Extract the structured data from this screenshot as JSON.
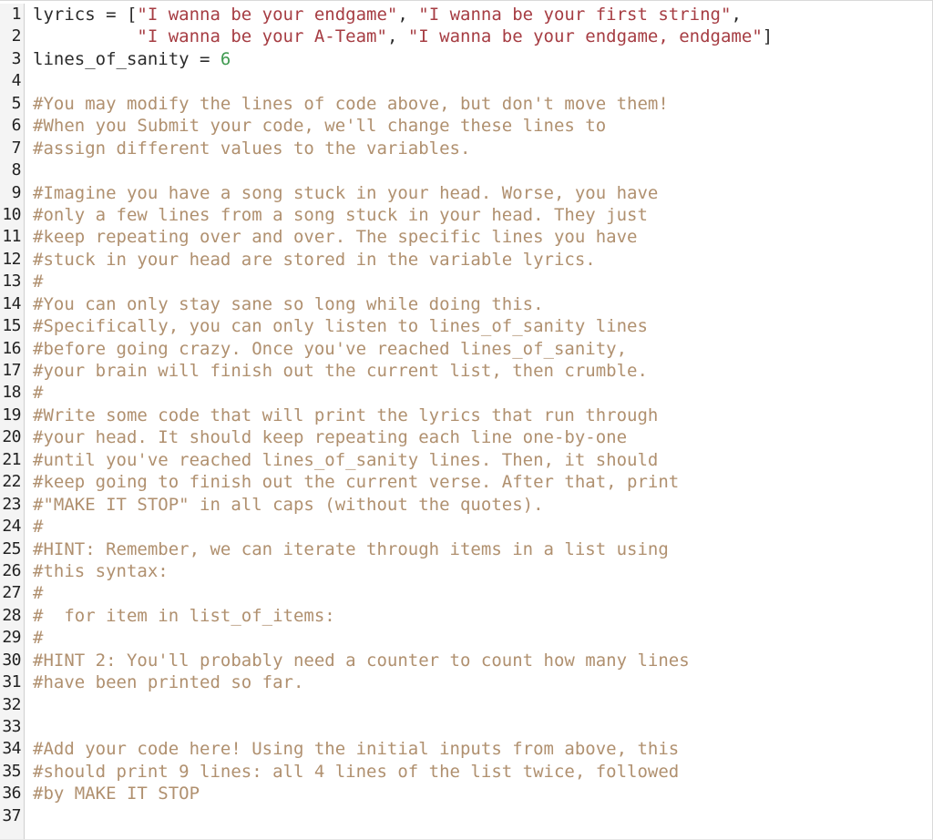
{
  "editor": {
    "language": "python",
    "total_lines": 37,
    "colors": {
      "background": "#ffffff",
      "gutter_background": "#f4f4f4",
      "gutter_border": "#cfcfcf",
      "line_number_text": "#222222",
      "plain_text": "#2b2b2b",
      "string": "#a63d43",
      "number": "#3f9a50",
      "comment": "#b0906f"
    },
    "line_numbers": [
      "1",
      "2",
      "3",
      "4",
      "5",
      "6",
      "7",
      "8",
      "9",
      "10",
      "11",
      "12",
      "13",
      "14",
      "15",
      "16",
      "17",
      "18",
      "19",
      "20",
      "21",
      "22",
      "23",
      "24",
      "25",
      "26",
      "27",
      "28",
      "29",
      "30",
      "31",
      "32",
      "33",
      "34",
      "35",
      "36",
      "37"
    ],
    "lines": [
      {
        "n": "1",
        "tokens": [
          {
            "t": "lyrics = [",
            "c": "plain"
          },
          {
            "t": "\"I wanna be your endgame\"",
            "c": "string"
          },
          {
            "t": ", ",
            "c": "plain"
          },
          {
            "t": "\"I wanna be your first string\"",
            "c": "string"
          },
          {
            "t": ",",
            "c": "plain"
          }
        ]
      },
      {
        "n": "2",
        "tokens": [
          {
            "t": "          ",
            "c": "plain"
          },
          {
            "t": "\"I wanna be your A-Team\"",
            "c": "string"
          },
          {
            "t": ", ",
            "c": "plain"
          },
          {
            "t": "\"I wanna be your endgame, endgame\"",
            "c": "string"
          },
          {
            "t": "]",
            "c": "plain"
          }
        ]
      },
      {
        "n": "3",
        "tokens": [
          {
            "t": "lines_of_sanity = ",
            "c": "plain"
          },
          {
            "t": "6",
            "c": "number"
          }
        ]
      },
      {
        "n": "4",
        "tokens": []
      },
      {
        "n": "5",
        "tokens": [
          {
            "t": "#You may modify the lines of code above, but don't move them!",
            "c": "comment"
          }
        ]
      },
      {
        "n": "6",
        "tokens": [
          {
            "t": "#When you Submit your code, we'll change these lines to",
            "c": "comment"
          }
        ]
      },
      {
        "n": "7",
        "tokens": [
          {
            "t": "#assign different values to the variables.",
            "c": "comment"
          }
        ]
      },
      {
        "n": "8",
        "tokens": []
      },
      {
        "n": "9",
        "tokens": [
          {
            "t": "#Imagine you have a song stuck in your head. Worse, you have",
            "c": "comment"
          }
        ]
      },
      {
        "n": "10",
        "tokens": [
          {
            "t": "#only a few lines from a song stuck in your head. They just",
            "c": "comment"
          }
        ]
      },
      {
        "n": "11",
        "tokens": [
          {
            "t": "#keep repeating over and over. The specific lines you have",
            "c": "comment"
          }
        ]
      },
      {
        "n": "12",
        "tokens": [
          {
            "t": "#stuck in your head are stored in the variable lyrics.",
            "c": "comment"
          }
        ]
      },
      {
        "n": "13",
        "tokens": [
          {
            "t": "#",
            "c": "comment"
          }
        ]
      },
      {
        "n": "14",
        "tokens": [
          {
            "t": "#You can only stay sane so long while doing this.",
            "c": "comment"
          }
        ]
      },
      {
        "n": "15",
        "tokens": [
          {
            "t": "#Specifically, you can only listen to lines_of_sanity lines",
            "c": "comment"
          }
        ]
      },
      {
        "n": "16",
        "tokens": [
          {
            "t": "#before going crazy. Once you've reached lines_of_sanity,",
            "c": "comment"
          }
        ]
      },
      {
        "n": "17",
        "tokens": [
          {
            "t": "#your brain will finish out the current list, then crumble.",
            "c": "comment"
          }
        ]
      },
      {
        "n": "18",
        "tokens": [
          {
            "t": "#",
            "c": "comment"
          }
        ]
      },
      {
        "n": "19",
        "tokens": [
          {
            "t": "#Write some code that will print the lyrics that run through",
            "c": "comment"
          }
        ]
      },
      {
        "n": "20",
        "tokens": [
          {
            "t": "#your head. It should keep repeating each line one-by-one",
            "c": "comment"
          }
        ]
      },
      {
        "n": "21",
        "tokens": [
          {
            "t": "#until you've reached lines_of_sanity lines. Then, it should",
            "c": "comment"
          }
        ]
      },
      {
        "n": "22",
        "tokens": [
          {
            "t": "#keep going to finish out the current verse. After that, print",
            "c": "comment"
          }
        ]
      },
      {
        "n": "23",
        "tokens": [
          {
            "t": "#\"MAKE IT STOP\" in all caps (without the quotes).",
            "c": "comment"
          }
        ]
      },
      {
        "n": "24",
        "tokens": [
          {
            "t": "#",
            "c": "comment"
          }
        ]
      },
      {
        "n": "25",
        "tokens": [
          {
            "t": "#HINT: Remember, we can iterate through items in a list using",
            "c": "comment"
          }
        ]
      },
      {
        "n": "26",
        "tokens": [
          {
            "t": "#this syntax:",
            "c": "comment"
          }
        ]
      },
      {
        "n": "27",
        "tokens": [
          {
            "t": "#",
            "c": "comment"
          }
        ]
      },
      {
        "n": "28",
        "tokens": [
          {
            "t": "#  for item in list_of_items:",
            "c": "comment"
          }
        ]
      },
      {
        "n": "29",
        "tokens": [
          {
            "t": "#",
            "c": "comment"
          }
        ]
      },
      {
        "n": "30",
        "tokens": [
          {
            "t": "#HINT 2: You'll probably need a counter to count how many lines",
            "c": "comment"
          }
        ]
      },
      {
        "n": "31",
        "tokens": [
          {
            "t": "#have been printed so far.",
            "c": "comment"
          }
        ]
      },
      {
        "n": "32",
        "tokens": []
      },
      {
        "n": "33",
        "tokens": []
      },
      {
        "n": "34",
        "tokens": [
          {
            "t": "#Add your code here! Using the initial inputs from above, this",
            "c": "comment"
          }
        ]
      },
      {
        "n": "35",
        "tokens": [
          {
            "t": "#should print 9 lines: all 4 lines of the list twice, followed",
            "c": "comment"
          }
        ]
      },
      {
        "n": "36",
        "tokens": [
          {
            "t": "#by MAKE IT STOP",
            "c": "comment"
          }
        ]
      },
      {
        "n": "37",
        "tokens": []
      }
    ]
  }
}
